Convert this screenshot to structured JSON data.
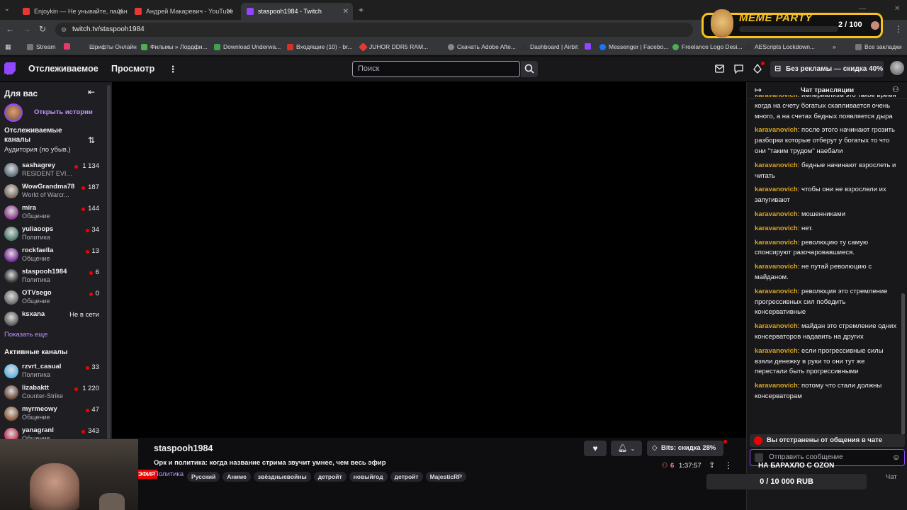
{
  "browser": {
    "tabs": [
      {
        "title": "Enjoykin — Не унывайте, пацаны",
        "color": "#e53935"
      },
      {
        "title": "Андрей Макаревич - YouTube",
        "color": "#e53935"
      },
      {
        "title": "staspooh1984 - Twitch",
        "color": "#9147ff",
        "active": true
      }
    ],
    "new_tab": "+",
    "url": "twitch.tv/staspooh1984",
    "bookmarks": [
      "Stream",
      "Шрифты Онлайн",
      "Фильмы » Лордфи...",
      "Download Underwa...",
      "Входящие (10) - br...",
      "JUHOR DDR5 RAM...",
      "Скачать Adobe Afte...",
      "Dashboard | Airbit",
      "Messenger | Facebo...",
      "Freelance Logo Desi...",
      "AEScripts Lockdown..."
    ],
    "all_bookmarks": "Все закладки"
  },
  "meme_overlay": {
    "label": "MEME PARTY",
    "count": "2 / 100"
  },
  "twitch_nav": {
    "following": "Отслеживаемое",
    "browse": "Просмотр",
    "search_placeholder": "Поиск",
    "no_ads": "Без рекламы — скидка 40%"
  },
  "sidebar": {
    "title": "Для вас",
    "stories": "Открыть истории",
    "followed_title": "Отслеживаемые каналы",
    "sort_label": "Аудитория (по убыв.)",
    "followed": [
      {
        "name": "sashagrey",
        "game": "RESIDENT EVIL...",
        "viewers": "1 134",
        "live": true,
        "color": "#5a6b7a"
      },
      {
        "name": "WowGrandma78",
        "game": "World of Warcr...",
        "viewers": "187",
        "live": true,
        "color": "#7a6a5a"
      },
      {
        "name": "mira",
        "game": "Общение",
        "viewers": "144",
        "live": true,
        "color": "#8a3a8a"
      },
      {
        "name": "yuliaoops",
        "game": "Политика",
        "viewers": "34",
        "live": true,
        "color": "#4a7a6a"
      },
      {
        "name": "rockfaella",
        "game": "Общение",
        "viewers": "13",
        "live": true,
        "color": "#7a2a9a"
      },
      {
        "name": "staspooh1984",
        "game": "Политика",
        "viewers": "6",
        "live": true,
        "color": "#2a2a2a"
      },
      {
        "name": "OTVsego",
        "game": "Общение",
        "viewers": "0",
        "live": true,
        "color": "#6a6a6a"
      },
      {
        "name": "ksxana",
        "game": "",
        "viewers": "Не в сети",
        "live": false,
        "color": "#5a5a5a"
      }
    ],
    "show_more": "Показать еще",
    "active_title": "Активные каналы",
    "active": [
      {
        "name": "rzvrt_casual",
        "game": "Политика",
        "viewers": "33",
        "color": "#5ab4e8"
      },
      {
        "name": "lizabaktt",
        "game": "Counter-Strike",
        "viewers": "1 220",
        "color": "#6a4a3a"
      },
      {
        "name": "myrmeowy",
        "game": "Общение",
        "viewers": "47",
        "color": "#8a5a3a"
      },
      {
        "name": "yanagranl",
        "game": "Общение",
        "viewers": "343",
        "color": "#c03050"
      }
    ]
  },
  "stream": {
    "channel": "staspooh1984",
    "title": "Орк и политика: когда название стрима звучит умнее, чем весь эфир",
    "category": "Политика",
    "tags": [
      "Русский",
      "Аниме",
      "звёздныевойны",
      "детройт",
      "новыйгод",
      "детройт",
      "MajesticRP"
    ],
    "viewers": "6",
    "uptime": "1:37:57",
    "bits": "Bits: скидка 28%",
    "live_badge": "ЭФИР"
  },
  "chat": {
    "title": "Чат трансляции",
    "messages": [
      {
        "user": "karavanovich",
        "text": "империализм это такое время когда на счету богатых скапливается очень много, а на счетах бедных появляется дыра"
      },
      {
        "user": "karavanovich",
        "text": "после этого начинают грозить разборки которые отберут у богатых то что они \"таким трудом\" наебали"
      },
      {
        "user": "karavanovich",
        "text": "бедные начинают взрослеть и читать"
      },
      {
        "user": "karavanovich",
        "text": "чтобы они не взрослели их запугивают"
      },
      {
        "user": "karavanovich",
        "text": "мошенниками"
      },
      {
        "user": "karavanovich",
        "text": "нет."
      },
      {
        "user": "karavanovich",
        "text": "революцию ту самую спонсируют разочаровавшиеся."
      },
      {
        "user": "karavanovich",
        "text": "не путай революцию с майданом."
      },
      {
        "user": "karavanovich",
        "text": "революция это стремление прогрессивных сил победить консервативные"
      },
      {
        "user": "karavanovich",
        "text": "майдан это стремление одних консерваторов надавить на других"
      },
      {
        "user": "karavanovich",
        "text": "если прогрессивные силы взяли денежку в руки то они тут же перестали быть прогрессивными"
      },
      {
        "user": "karavanovich",
        "text": "потому что стали должны консерваторам"
      }
    ],
    "banned": "Вы отстранены от общения в чате",
    "input_placeholder": "Отправить сообщение",
    "chat_button": "Чат"
  },
  "overlays": {
    "ozon": "НА БАРАХЛО С OZON",
    "goal": "0 / 10 000 RUB"
  }
}
